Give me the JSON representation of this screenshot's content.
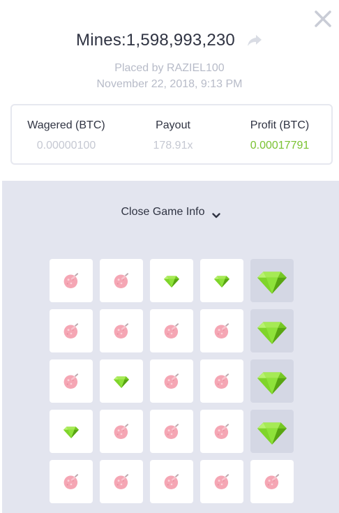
{
  "header": {
    "title": "Mines:1,598,993,230",
    "placed_by": "Placed by RAZIEL100",
    "date": "November 22, 2018, 9:13 PM"
  },
  "stats": {
    "wagered_label": "Wagered (BTC)",
    "wagered_value": "0.00000100",
    "payout_label": "Payout",
    "payout_value": "178.91x",
    "profit_label": "Profit (BTC)",
    "profit_value": "0.00017791"
  },
  "game": {
    "toggle_label": "Close Game Info",
    "icons": {
      "mine": "mine-icon",
      "gem": "gem-icon",
      "close": "close-icon",
      "share": "share-icon",
      "chevron": "chevron-down-icon"
    },
    "colors": {
      "gem": "#7ed321",
      "mine": "#f4a3b0",
      "profit": "#7ac231",
      "panel": "#e3e5ef"
    },
    "board": [
      [
        {
          "type": "mine",
          "revealed": false
        },
        {
          "type": "mine",
          "revealed": false
        },
        {
          "type": "gem",
          "revealed": false
        },
        {
          "type": "gem",
          "revealed": false
        },
        {
          "type": "gem",
          "revealed": true
        }
      ],
      [
        {
          "type": "mine",
          "revealed": false
        },
        {
          "type": "mine",
          "revealed": false
        },
        {
          "type": "mine",
          "revealed": false
        },
        {
          "type": "mine",
          "revealed": false
        },
        {
          "type": "gem",
          "revealed": true
        }
      ],
      [
        {
          "type": "mine",
          "revealed": false
        },
        {
          "type": "gem",
          "revealed": false
        },
        {
          "type": "mine",
          "revealed": false
        },
        {
          "type": "mine",
          "revealed": false
        },
        {
          "type": "gem",
          "revealed": true
        }
      ],
      [
        {
          "type": "gem",
          "revealed": false
        },
        {
          "type": "mine",
          "revealed": false
        },
        {
          "type": "mine",
          "revealed": false
        },
        {
          "type": "mine",
          "revealed": false
        },
        {
          "type": "gem",
          "revealed": true
        }
      ],
      [
        {
          "type": "mine",
          "revealed": false
        },
        {
          "type": "mine",
          "revealed": false
        },
        {
          "type": "mine",
          "revealed": false
        },
        {
          "type": "mine",
          "revealed": false
        },
        {
          "type": "mine",
          "revealed": false
        }
      ]
    ]
  }
}
